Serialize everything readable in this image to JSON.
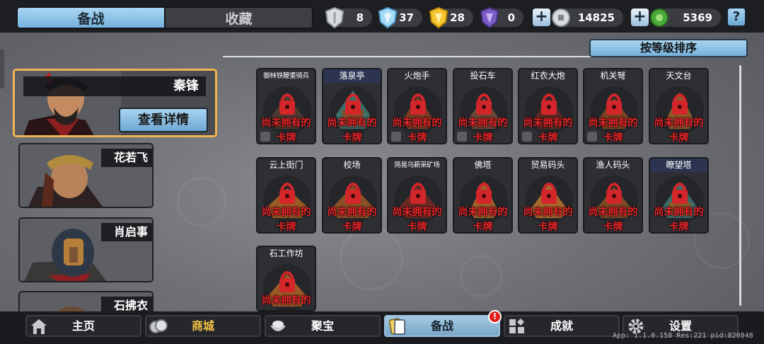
{
  "tabs": [
    {
      "label": "备战"
    },
    {
      "label": "收藏"
    }
  ],
  "currencies": [
    {
      "icon": "silver-shield-icon",
      "value": "8"
    },
    {
      "icon": "blue-crystal-shield-icon",
      "value": "37"
    },
    {
      "icon": "gold-shield-icon",
      "value": "28"
    },
    {
      "icon": "purple-shield-icon",
      "value": "0"
    },
    {
      "icon": "silver-coin-icon",
      "value": "14825"
    },
    {
      "icon": "jade-coin-icon",
      "value": "5369"
    }
  ],
  "help_label": "?",
  "sort_label": "按等级排序",
  "heroes": [
    {
      "name": "秦锋",
      "selected": true
    },
    {
      "name": "花若飞"
    },
    {
      "name": "肖启事"
    },
    {
      "name": "石拂衣"
    }
  ],
  "detail_button": "查看详情",
  "locked_lines": [
    "尚未拥有的",
    "卡牌"
  ],
  "buildings": [
    {
      "name": "御林铁鞭重骑兵"
    },
    {
      "name": "落泉亭"
    },
    {
      "name": "火炮手"
    },
    {
      "name": "投石车"
    },
    {
      "name": "红衣大炮"
    },
    {
      "name": "机关弩"
    },
    {
      "name": "天文台"
    },
    {
      "name": "云上街门"
    },
    {
      "name": "校场"
    },
    {
      "name": "简易乌薪采矿场"
    },
    {
      "name": "佛塔"
    },
    {
      "name": "贸易码头"
    },
    {
      "name": "渔人码头"
    },
    {
      "name": "瞭望塔"
    },
    {
      "name": "石工作坊"
    }
  ],
  "nav": [
    {
      "label": "主页",
      "icon": "home-icon"
    },
    {
      "label": "商城",
      "icon": "coins-icon"
    },
    {
      "label": "聚宝",
      "icon": "treasure-bowl-icon"
    },
    {
      "label": "备战",
      "icon": "cards-icon"
    },
    {
      "label": "成就",
      "icon": "achievement-icon"
    },
    {
      "label": "设置",
      "icon": "gear-icon"
    }
  ],
  "badge": "!",
  "version_text": "App: 1.1.0.158 Res:221 pid:820848",
  "colors": {
    "accent": "#7ab6df",
    "selected_border": "#f0b451",
    "lock_red": "#e8262a",
    "shop_gold": "#f5c343"
  }
}
